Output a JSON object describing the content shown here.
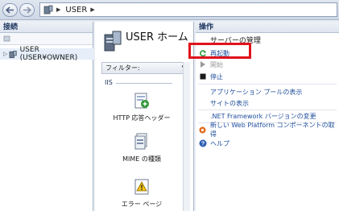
{
  "address_bar": {
    "segment": "USER"
  },
  "connections": {
    "title": "接続",
    "tree_item": "USER (USER¥OWNER)"
  },
  "home": {
    "title": "USER ホーム",
    "filter_label": "フィルター:",
    "group_label": "IIS",
    "features": [
      {
        "label": "HTTP 応答ヘッダー",
        "icon": "http-response-headers-icon"
      },
      {
        "label": "MIME の種類",
        "icon": "mime-types-icon"
      },
      {
        "label": "エラー ページ",
        "icon": "error-pages-icon"
      }
    ]
  },
  "actions": {
    "title": "操作",
    "group_title": "サーバーの管理",
    "items": [
      {
        "label": "再起動",
        "icon": "restart-icon",
        "state": "link"
      },
      {
        "label": "開始",
        "icon": "start-icon",
        "state": "disabled"
      },
      {
        "label": "停止",
        "icon": "stop-icon",
        "state": "link"
      },
      {
        "label": "アプリケーション プールの表示",
        "state": "link"
      },
      {
        "label": "サイトの表示",
        "state": "link"
      },
      {
        "label": ".NET Framework バージョンの変更",
        "state": "link"
      },
      {
        "label": "新しい Web Platform コンポーネントの取得",
        "icon": "web-platform-icon",
        "state": "link"
      },
      {
        "label": "ヘルプ",
        "icon": "help-icon",
        "state": "link"
      }
    ]
  },
  "colors": {
    "highlight": "#e0121c",
    "link": "#1f4e9c"
  }
}
